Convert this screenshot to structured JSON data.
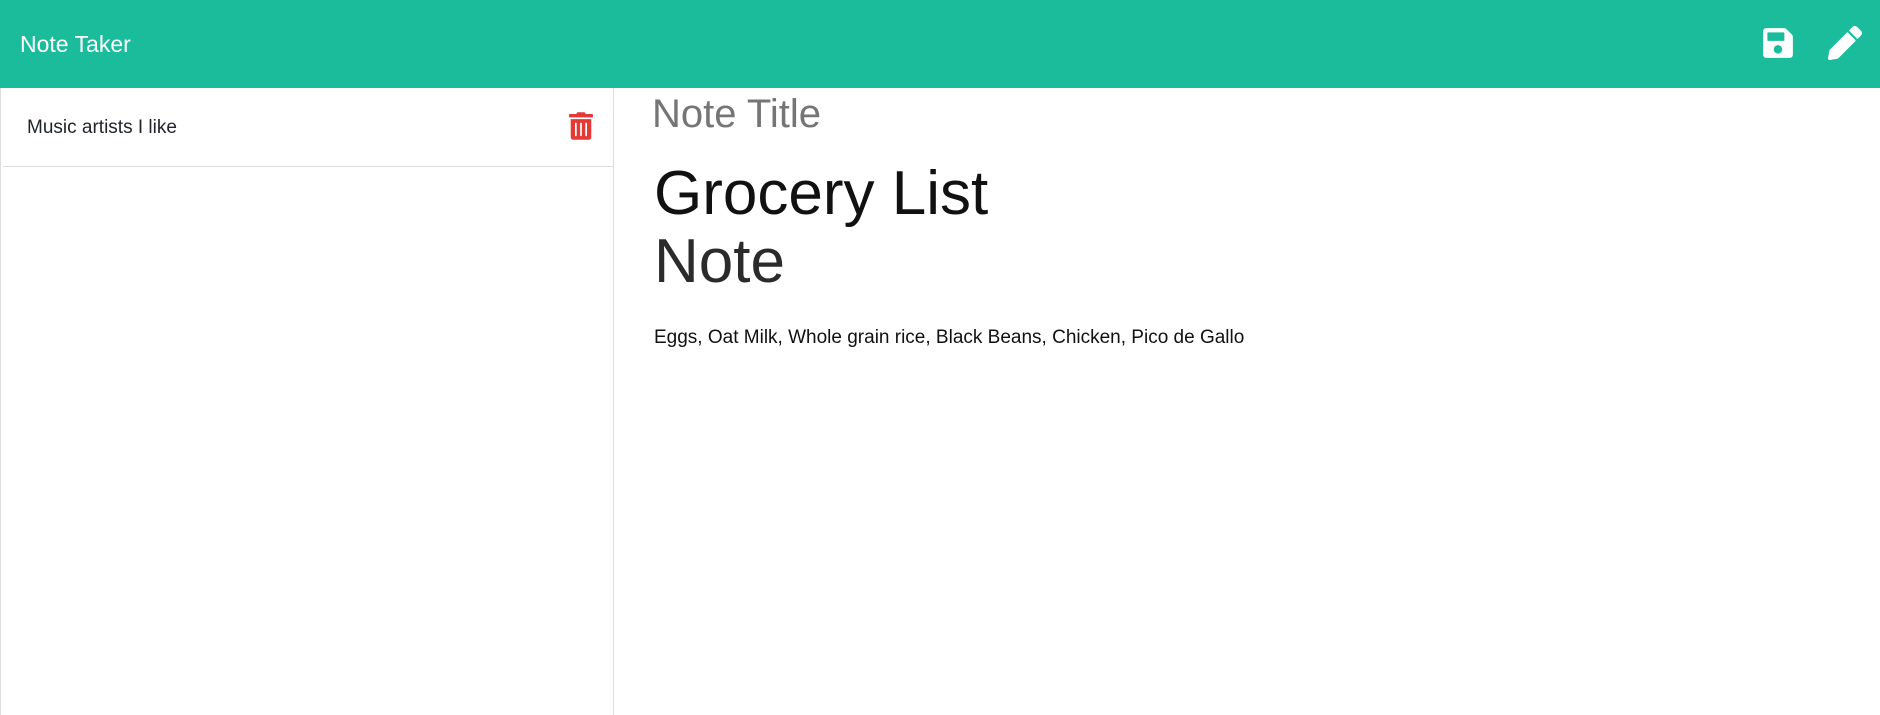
{
  "app": {
    "brand": "Note Taker",
    "accent_color": "#1abc9c",
    "delete_color": "#e53935",
    "icons": {
      "save": "save-icon",
      "edit": "pencil-icon",
      "delete": "trash-icon"
    }
  },
  "sidebar": {
    "notes": [
      {
        "title": "Music artists I like"
      }
    ]
  },
  "editor": {
    "title_placeholder": "Note Title",
    "heading_line1": "Grocery List",
    "heading_line2": "Note",
    "body_text": "Eggs, Oat Milk, Whole grain rice, Black Beans, Chicken, Pico de Gallo"
  }
}
